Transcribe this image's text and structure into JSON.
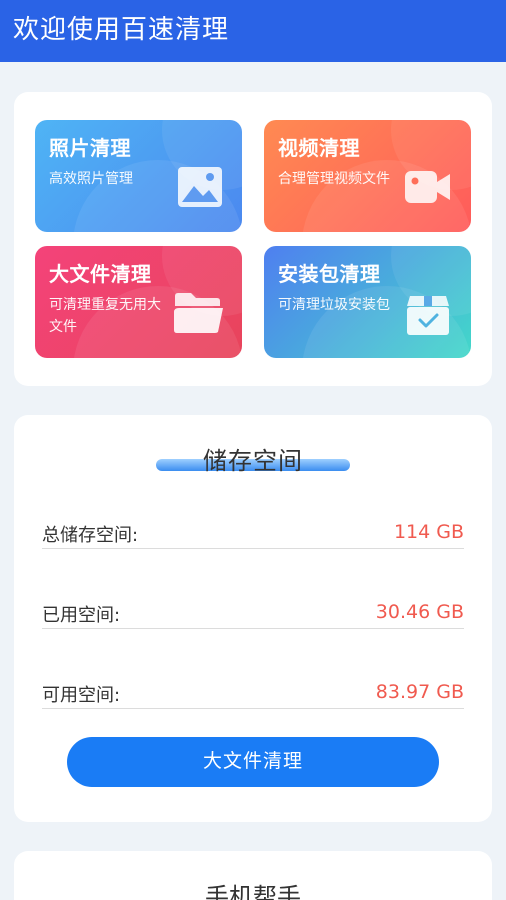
{
  "header": {
    "title": "欢迎使用百速清理"
  },
  "tools": {
    "photo": {
      "title": "照片清理",
      "desc": "高效照片管理",
      "icon": "image-icon"
    },
    "video": {
      "title": "视频清理",
      "desc": "合理管理视频文件",
      "icon": "video-camera-icon"
    },
    "bigfile": {
      "title": "大文件清理",
      "desc": "可清理重复无用大文件",
      "icon": "folder-icon"
    },
    "apk": {
      "title": "安装包清理",
      "desc": "可清理垃圾安装包",
      "icon": "package-icon"
    }
  },
  "storage": {
    "title": "储存空间",
    "total": {
      "label": "总储存空间:",
      "value": "114 GB"
    },
    "used": {
      "label": "已用空间:",
      "value": "30.46 GB"
    },
    "free": {
      "label": "可用空间:",
      "value": "83.97 GB"
    },
    "button_label": "大文件清理"
  },
  "help": {
    "title": "手机帮手"
  },
  "colors": {
    "header": "#2a63e6",
    "accent": "#1a7cf5",
    "value_red": "#f05a4f"
  }
}
